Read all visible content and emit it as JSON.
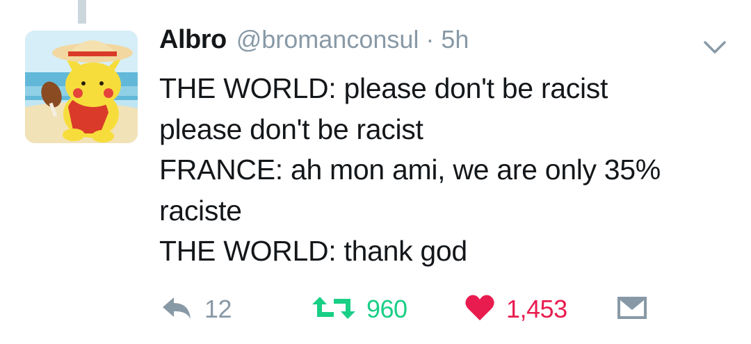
{
  "tweet": {
    "display_name": "Albro",
    "handle": "@bromanconsul",
    "separator": "·",
    "time": "5h",
    "lines": [
      "THE WORLD: please don't be racist",
      "please don't be racist",
      "FRANCE: ah mon ami, we are only 35%",
      "raciste",
      "THE WORLD: thank god"
    ]
  },
  "actions": {
    "reply_count": "12",
    "retweet_count": "960",
    "like_count": "1,453"
  },
  "icons": {
    "reply": "reply-icon",
    "retweet": "retweet-icon",
    "like": "heart-icon",
    "message": "direct-message-icon",
    "menu": "chevron-down-icon"
  },
  "colors": {
    "name": "#14171a",
    "secondary": "#8899a6",
    "retweet": "#19cf86",
    "like": "#e81c4f"
  }
}
